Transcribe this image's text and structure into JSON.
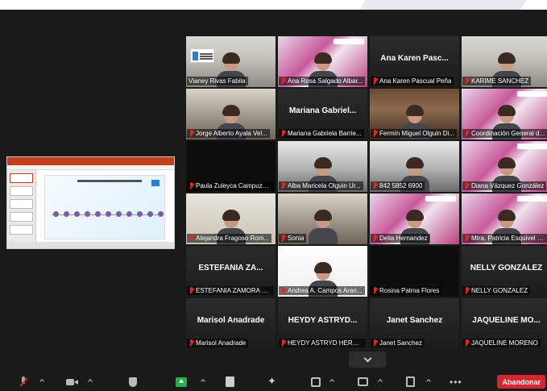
{
  "tiles": [
    {
      "name": "Vianey Rivas Fabila",
      "center": "",
      "muted": false,
      "active": true
    },
    {
      "name": "Ana Rosa Salgado Albar...",
      "center": "",
      "muted": true,
      "active": false
    },
    {
      "name": "Ana Karen Pascual Peña",
      "center": "Ana Karen Pasc...",
      "muted": true,
      "active": false
    },
    {
      "name": "KARIME SANCHEZ",
      "center": "",
      "muted": true,
      "active": false
    },
    {
      "name": "Jorge Alberto Ayala Vel...",
      "center": "",
      "muted": true,
      "active": false
    },
    {
      "name": "Mariana Gabriela Barrie...",
      "center": "Mariana Gabriel...",
      "muted": true,
      "active": false
    },
    {
      "name": "Fermín Miguel Olguin Di...",
      "center": "",
      "muted": true,
      "active": false
    },
    {
      "name": "Coordinación General d...",
      "center": "",
      "muted": true,
      "active": false
    },
    {
      "name": "Paula Zuleyca Campuzano",
      "center": "",
      "muted": true,
      "active": false
    },
    {
      "name": "Alba Maricela Olguin Ur...",
      "center": "",
      "muted": true,
      "active": false
    },
    {
      "name": "842 5852 6900",
      "center": "",
      "muted": true,
      "active": false
    },
    {
      "name": "Diana Vázquez González",
      "center": "",
      "muted": true,
      "active": false
    },
    {
      "name": "Alejandra Fragoso Rom...",
      "center": "",
      "muted": true,
      "active": false
    },
    {
      "name": "Sonia",
      "center": "",
      "muted": true,
      "active": false
    },
    {
      "name": "Delia Hernandez",
      "center": "",
      "muted": true,
      "active": false
    },
    {
      "name": "Mtra. Patricia Esquivel R...",
      "center": "",
      "muted": true,
      "active": false
    },
    {
      "name": "ESTEFANIA ZAMORA GA...",
      "center": "ESTEFANIA ZA...",
      "muted": true,
      "active": false
    },
    {
      "name": "Andrea A. Campos Aran...",
      "center": "",
      "muted": true,
      "active": false
    },
    {
      "name": "Rosina Palma Flores",
      "center": "",
      "muted": true,
      "active": false
    },
    {
      "name": "NELLY GONZALEZ",
      "center": "NELLY GONZALEZ",
      "muted": true,
      "active": false
    },
    {
      "name": "Marisol Anadrade",
      "center": "Marisol Anadrade",
      "muted": true,
      "active": false
    },
    {
      "name": "HEYDY ASTRYD HERRER...",
      "center": "HEYDY ASTRYD...",
      "muted": true,
      "active": false
    },
    {
      "name": "Janet Sanchez",
      "center": "Janet Sanchez",
      "muted": true,
      "active": false
    },
    {
      "name": "JAQUELINE MORENO",
      "center": "JAQUELINE MO...",
      "muted": true,
      "active": false
    }
  ],
  "toolbar": {
    "leave_label": "Abandonar",
    "more_label": "•••",
    "icons": [
      "mic-muted-icon",
      "video-icon",
      "security-icon",
      "share-screen-icon",
      "document-icon",
      "sparkle-icon",
      "record-icon",
      "chat-icon",
      "notes-icon",
      "more-icon"
    ]
  },
  "colors": {
    "active_border": "#b4d13a",
    "muted_mic": "#e02828",
    "share_green": "#22b04b",
    "leave_red": "#d6262f"
  }
}
